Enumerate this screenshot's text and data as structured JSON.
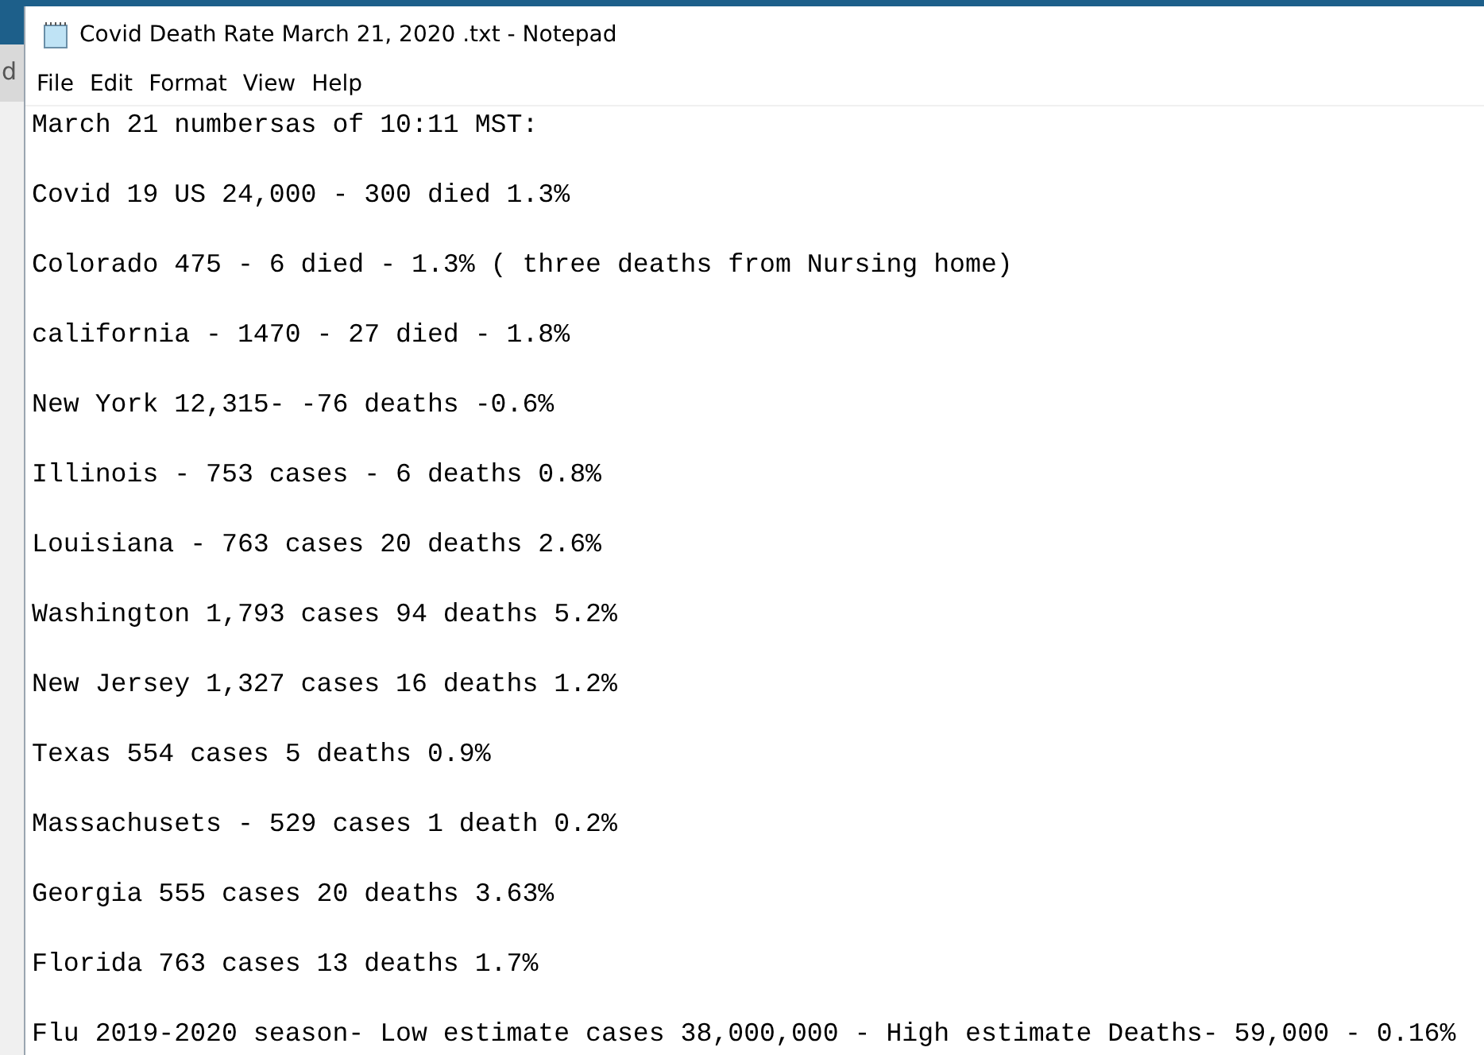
{
  "background_window": {
    "text": "d"
  },
  "window": {
    "title": "Covid Death Rate March 21, 2020 .txt - Notepad"
  },
  "menu": [
    "File",
    "Edit",
    "Format",
    "View",
    "Help"
  ],
  "lines": [
    "March 21 numbersas of 10:11 MST:",
    "Covid 19 US 24,000 - 300 died 1.3%",
    "Colorado 475 - 6 died - 1.3% ( three deaths from Nursing home)",
    "california - 1470 - 27 died - 1.8%",
    "New York 12,315- -76 deaths -0.6%",
    "Illinois - 753 cases - 6 deaths 0.8%",
    "Louisiana - 763 cases 20 deaths 2.6%",
    "Washington 1,793 cases 94 deaths 5.2%",
    "New Jersey 1,327 cases 16 deaths 1.2%",
    "Texas 554 cases 5 deaths 0.9%",
    "Massachusets - 529 cases 1 death 0.2%",
    "Georgia 555 cases 20 deaths 3.63%",
    "Florida 763 cases 13 deaths 1.7%",
    "Flu 2019-2020 season- Low estimate cases 38,000,000 - High estimate Deaths- 59,000 - 0.16%"
  ]
}
